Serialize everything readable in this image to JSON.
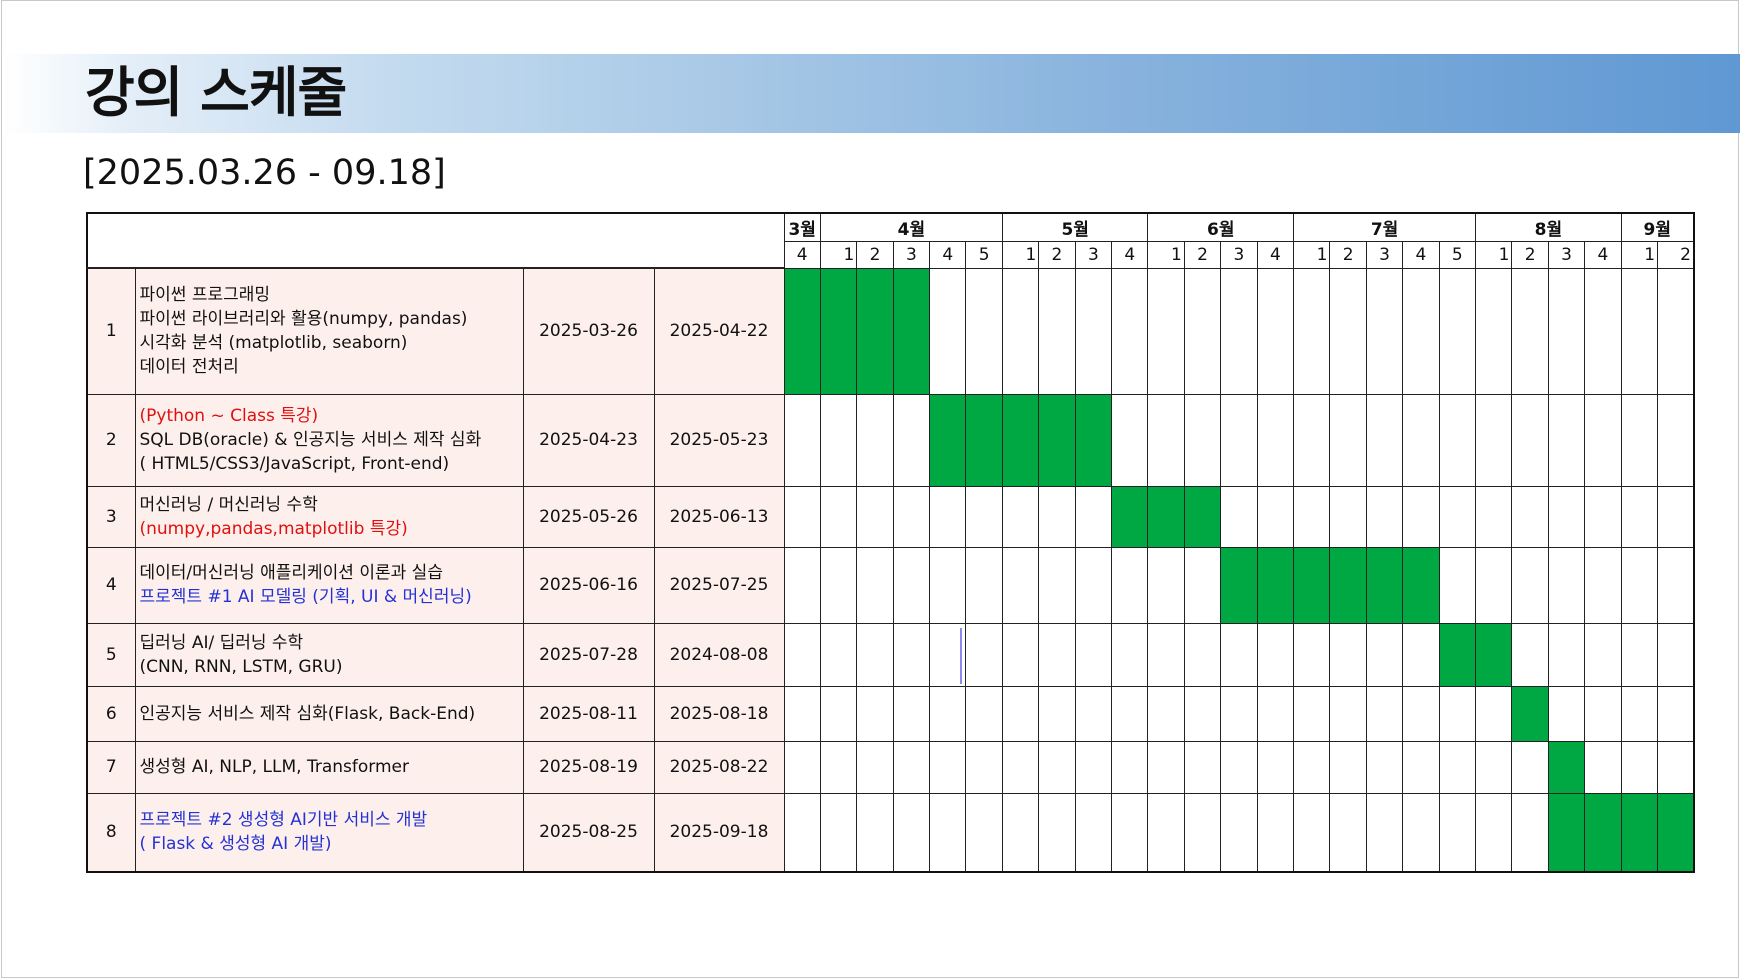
{
  "title": "강의 스케줄",
  "period": "[2025.03.26 - 09.18]",
  "colors": {
    "bar": "#00a843",
    "row_bg": "#fdf0ec",
    "header_band": "#5f98d3"
  },
  "months": [
    {
      "label": "3월",
      "weeks": [
        "4"
      ]
    },
    {
      "label": "4월",
      "weeks": [
        "1",
        "2",
        "3",
        "4",
        "5"
      ]
    },
    {
      "label": "5월",
      "weeks": [
        "1",
        "2",
        "3",
        "4"
      ]
    },
    {
      "label": "6월",
      "weeks": [
        "1",
        "2",
        "3",
        "4"
      ]
    },
    {
      "label": "7월",
      "weeks": [
        "1",
        "2",
        "3",
        "4",
        "5"
      ]
    },
    {
      "label": "8월",
      "weeks": [
        "1",
        "2",
        "3",
        "4"
      ]
    },
    {
      "label": "9월",
      "weeks": [
        "1",
        "2"
      ]
    }
  ],
  "rows": [
    {
      "no": "1",
      "lines": [
        {
          "text": "파이썬 프로그래밍",
          "color": "black"
        },
        {
          "text": "파이썬 라이브러리와 활용(numpy, pandas)",
          "color": "black"
        },
        {
          "text": "시각화 분석 (matplotlib, seaborn)",
          "color": "black"
        },
        {
          "text": "데이터 전처리",
          "color": "black"
        }
      ],
      "start": "2025-03-26",
      "end": "2025-04-22",
      "weeks_active": [
        0,
        1,
        2,
        3
      ]
    },
    {
      "no": "2",
      "lines": [
        {
          "text": "(Python ~ Class 특강)",
          "color": "red"
        },
        {
          "text": "SQL DB(oracle) & 인공지능 서비스 제작 심화",
          "color": "black"
        },
        {
          "text": "( HTML5/CSS3/JavaScript, Front-end)",
          "color": "black"
        }
      ],
      "start": "2025-04-23",
      "end": "2025-05-23",
      "weeks_active": [
        4,
        5,
        6,
        7,
        8
      ]
    },
    {
      "no": "3",
      "lines": [
        {
          "text": "머신러닝 / 머신러닝 수학",
          "color": "black"
        },
        {
          "text": "(numpy,pandas,matplotlib 특강)",
          "color": "red"
        }
      ],
      "start": "2025-05-26",
      "end": "2025-06-13",
      "weeks_active": [
        9,
        10,
        11
      ]
    },
    {
      "no": "4",
      "lines": [
        {
          "text": "데이터/머신러닝 애플리케이션 이론과 실습",
          "color": "black"
        },
        {
          "text": "프로젝트 #1 AI 모델링 (기획, UI & 머신러닝)",
          "color": "blue"
        }
      ],
      "start": "2025-06-16",
      "end": "2025-07-25",
      "weeks_active": [
        12,
        13,
        14,
        15,
        16,
        17
      ]
    },
    {
      "no": "5",
      "lines": [
        {
          "text": "딥러닝 AI/ 딥러닝 수학",
          "color": "black"
        },
        {
          "text": "(CNN, RNN, LSTM, GRU)",
          "color": "black"
        }
      ],
      "start": "2025-07-28",
      "end": "2024-08-08",
      "weeks_active": [
        18,
        19
      ]
    },
    {
      "no": "6",
      "lines": [
        {
          "text": "인공지능 서비스 제작 심화(Flask, Back-End)",
          "color": "black"
        }
      ],
      "start": "2025-08-11",
      "end": "2025-08-18",
      "weeks_active": [
        20
      ]
    },
    {
      "no": "7",
      "lines": [
        {
          "text": "생성형 AI, NLP, LLM, Transformer",
          "color": "black"
        }
      ],
      "start": "2025-08-19",
      "end": "2025-08-22",
      "weeks_active": [
        21
      ]
    },
    {
      "no": "8",
      "lines": [
        {
          "text": "프로젝트 #2 생성형 AI기반 서비스 개발",
          "color": "blue"
        },
        {
          "text": "( Flask & 생성형 AI 개발)",
          "color": "blue"
        }
      ],
      "start": "2025-08-25",
      "end": "2025-09-18",
      "weeks_active": [
        21,
        22,
        23,
        24
      ]
    }
  ]
}
